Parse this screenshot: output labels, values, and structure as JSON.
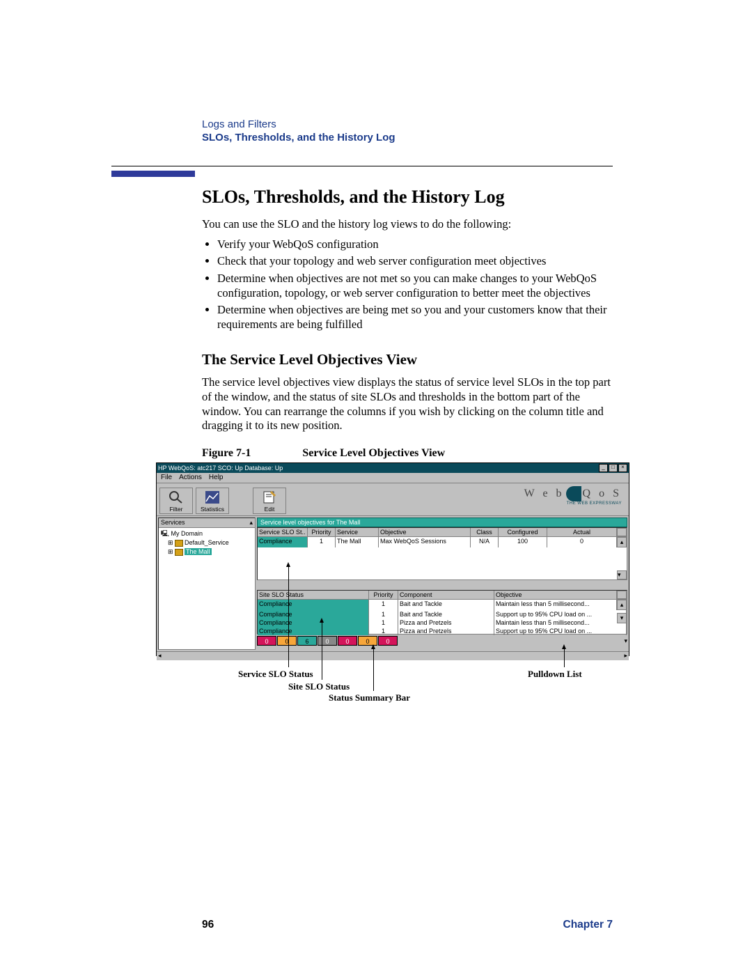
{
  "header": {
    "chapter": "Logs and Filters",
    "section": "SLOs, Thresholds, and the History Log"
  },
  "h1": "SLOs, Thresholds, and the History Log",
  "intro": "You can use the SLO and the history log views to do the following:",
  "bullets": [
    "Verify your WebQoS configuration",
    "Check that your topology and web server configuration meet objectives",
    "Determine when objectives are not met so you can make changes to your WebQoS configuration, topology, or web server configuration to better meet the objectives",
    "Determine when objectives are being met so you and your customers know that their requirements are being fulfilled"
  ],
  "h2": "The Service Level Objectives View",
  "para2": "The service level objectives view displays the status of service level SLOs in the top part of the window, and the status of site SLOs and thresholds in the bottom part of the window. You can rearrange the columns if you wish by clicking on the column title and dragging it to its new position.",
  "fig": {
    "num": "Figure 7-1",
    "title": "Service Level Objectives View"
  },
  "win": {
    "title": "HP WebQoS: atc217   SCO: Up   Database: Up",
    "menus": [
      "File",
      "Actions",
      "Help"
    ],
    "toolbar": [
      {
        "label": "Filter",
        "icon": "magnifier"
      },
      {
        "label": "Statistics",
        "icon": "chart"
      },
      {
        "label": "Edit",
        "icon": "notepad"
      }
    ],
    "logo": {
      "text1": "W e b",
      "text2": "Q o S",
      "sub": "THE WEB EXPRESSWAY"
    },
    "tree": {
      "header": "Services",
      "items": [
        "My Domain",
        "Default_Service",
        "The Mall"
      ],
      "selected": "The Mall"
    },
    "panel_title": "Service level objectives for The Mall",
    "table1": {
      "headers": [
        "Service SLO St..",
        "Priority",
        "Service",
        "Objective",
        "Class",
        "Configured",
        "Actual"
      ],
      "row": {
        "status": "Compliance",
        "priority": "1",
        "service": "The Mall",
        "objective": "Max WebQoS Sessions",
        "class": "N/A",
        "configured": "100",
        "actual": "0"
      }
    },
    "table2": {
      "headers": [
        "Site SLO Status",
        "Priority",
        "Component",
        "Objective"
      ],
      "rows": [
        {
          "status": "Compliance",
          "priority": "1",
          "component": "Bait and Tackle",
          "objective": "Maintain less than 5 millisecond..."
        },
        {
          "status": "Compliance",
          "priority": "1",
          "component": "Bait and Tackle",
          "objective": "Support up to 95% CPU load on ..."
        },
        {
          "status": "Compliance",
          "priority": "1",
          "component": "Pizza and Pretzels",
          "objective": "Maintain less than 5 millisecond..."
        },
        {
          "status": "Compliance",
          "priority": "1",
          "component": "Pizza and Pretzels",
          "objective": "Support up to 95% CPU load on ..."
        }
      ]
    },
    "statusbar": [
      "0",
      "0",
      "6",
      "0",
      "0",
      "0",
      "0"
    ]
  },
  "annotations": {
    "a1": "Service SLO Status",
    "a2": "Site SLO Status",
    "a3": "Status Summary Bar",
    "a4": "Pulldown List"
  },
  "footer": {
    "page": "96",
    "chapter": "Chapter 7"
  }
}
